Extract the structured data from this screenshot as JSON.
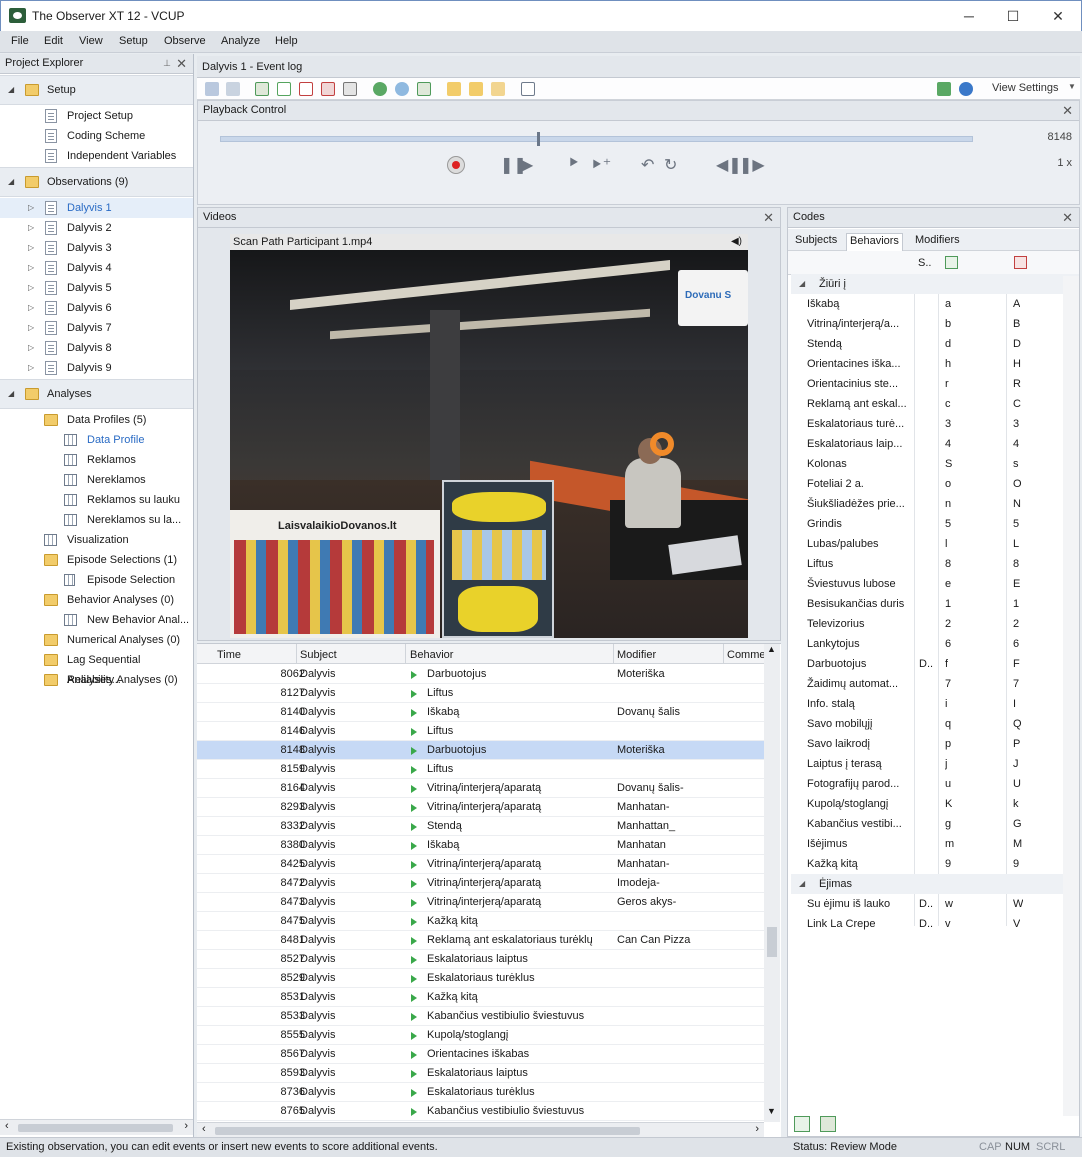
{
  "window": {
    "title": "The Observer XT 12 - VCUP",
    "minimize": "─",
    "maximize": "☐",
    "close": "✕"
  },
  "menu": [
    "File",
    "Edit",
    "View",
    "Setup",
    "Observe",
    "Analyze",
    "Help"
  ],
  "explorer": {
    "title": "Project Explorer",
    "pin": "📌",
    "close": "✕",
    "setup": {
      "label": "Setup",
      "items": [
        "Project Setup",
        "Coding Scheme",
        "Independent Variables"
      ]
    },
    "observations": {
      "label": "Observations (9)",
      "items": [
        "Dalyvis 1",
        "Dalyvis 2",
        "Dalyvis 3",
        "Dalyvis 4",
        "Dalyvis 5",
        "Dalyvis 6",
        "Dalyvis 7",
        "Dalyvis 8",
        "Dalyvis 9"
      ]
    },
    "analyses": {
      "label": "Analyses",
      "data_profiles": "Data Profiles (5)",
      "profiles": [
        "Data Profile",
        "Reklamos",
        "Nereklamos",
        "Reklamos su lauku",
        "Nereklamos su la..."
      ],
      "visualization": "Visualization",
      "episode_selections": "Episode Selections (1)",
      "episode_selection": "Episode Selection",
      "behavior_analyses": "Behavior Analyses (0)",
      "new_behavior": "New Behavior Anal...",
      "numerical": "Numerical Analyses (0)",
      "lag": "Lag Sequential Analyses...",
      "reliability": "Reliability Analyses (0)"
    }
  },
  "event_log_tab": "Dalyvis 1 - Event log",
  "view_settings": "View Settings",
  "playback": {
    "title": "Playback Control",
    "position": 0.42,
    "time": "8148",
    "speed": "1 x"
  },
  "videos": {
    "title": "Videos",
    "filename": "Scan Path Participant 1.mp4",
    "sign_text": "LaisvalaikioDovanos.lt",
    "sign_right": "Dovanu S"
  },
  "log": {
    "headers": [
      "Time",
      "Subject",
      "Behavior",
      "Modifier",
      "Comme"
    ],
    "rows": [
      {
        "time": "8062",
        "subject": "Dalyvis",
        "behavior": "Darbuotojus",
        "modifier": "Moteriška"
      },
      {
        "time": "8127",
        "subject": "Dalyvis",
        "behavior": "Liftus",
        "modifier": ""
      },
      {
        "time": "8140",
        "subject": "Dalyvis",
        "behavior": "Iškabą",
        "modifier": "Dovanų šalis"
      },
      {
        "time": "8146",
        "subject": "Dalyvis",
        "behavior": "Liftus",
        "modifier": ""
      },
      {
        "time": "8148",
        "subject": "Dalyvis",
        "behavior": "Darbuotojus",
        "modifier": "Moteriška"
      },
      {
        "time": "8159",
        "subject": "Dalyvis",
        "behavior": "Liftus",
        "modifier": ""
      },
      {
        "time": "8164",
        "subject": "Dalyvis",
        "behavior": "Vitriną/interjerą/aparatą",
        "modifier": "Dovanų šalis-"
      },
      {
        "time": "8293",
        "subject": "Dalyvis",
        "behavior": "Vitriną/interjerą/aparatą",
        "modifier": "Manhatan-"
      },
      {
        "time": "8332",
        "subject": "Dalyvis",
        "behavior": "Stendą",
        "modifier": "Manhattan_"
      },
      {
        "time": "8380",
        "subject": "Dalyvis",
        "behavior": "Iškabą",
        "modifier": "Manhatan"
      },
      {
        "time": "8425",
        "subject": "Dalyvis",
        "behavior": "Vitriną/interjerą/aparatą",
        "modifier": "Manhatan-"
      },
      {
        "time": "8472",
        "subject": "Dalyvis",
        "behavior": "Vitriną/interjerą/aparatą",
        "modifier": "Imodeja-"
      },
      {
        "time": "8473",
        "subject": "Dalyvis",
        "behavior": "Vitriną/interjerą/aparatą",
        "modifier": "Geros akys-"
      },
      {
        "time": "8475",
        "subject": "Dalyvis",
        "behavior": "Kažką kitą",
        "modifier": ""
      },
      {
        "time": "8481",
        "subject": "Dalyvis",
        "behavior": "Reklamą ant eskalatoriaus turėklų",
        "modifier": "Can Can Pizza"
      },
      {
        "time": "8527",
        "subject": "Dalyvis",
        "behavior": "Eskalatoriaus laiptus",
        "modifier": ""
      },
      {
        "time": "8529",
        "subject": "Dalyvis",
        "behavior": "Eskalatoriaus turėklus",
        "modifier": ""
      },
      {
        "time": "8531",
        "subject": "Dalyvis",
        "behavior": "Kažką kitą",
        "modifier": ""
      },
      {
        "time": "8533",
        "subject": "Dalyvis",
        "behavior": "Kabančius vestibiulio šviestuvus",
        "modifier": ""
      },
      {
        "time": "8555",
        "subject": "Dalyvis",
        "behavior": "Kupolą/stoglangį",
        "modifier": ""
      },
      {
        "time": "8567",
        "subject": "Dalyvis",
        "behavior": "Orientacines iškabas",
        "modifier": ""
      },
      {
        "time": "8593",
        "subject": "Dalyvis",
        "behavior": "Eskalatoriaus laiptus",
        "modifier": ""
      },
      {
        "time": "8736",
        "subject": "Dalyvis",
        "behavior": "Eskalatoriaus turėklus",
        "modifier": ""
      },
      {
        "time": "8765",
        "subject": "Dalyvis",
        "behavior": "Kabančius vestibiulio šviestuvus",
        "modifier": ""
      }
    ]
  },
  "codes": {
    "title": "Codes",
    "tabs": [
      "Subjects",
      "Behaviors",
      "Modifiers"
    ],
    "col_s": "S..",
    "group1": "Žiūri į",
    "rows1": [
      {
        "name": "Iškabą",
        "s": "",
        "key": "a",
        "end": "A"
      },
      {
        "name": "Vitriną/interjerą/a...",
        "s": "",
        "key": "b",
        "end": "B"
      },
      {
        "name": "Stendą",
        "s": "",
        "key": "d",
        "end": "D"
      },
      {
        "name": "Orientacines iška...",
        "s": "",
        "key": "h",
        "end": "H"
      },
      {
        "name": "Orientacinius ste...",
        "s": "",
        "key": "r",
        "end": "R"
      },
      {
        "name": "Reklamą ant eskal...",
        "s": "",
        "key": "c",
        "end": "C"
      },
      {
        "name": "Eskalatoriaus turė...",
        "s": "",
        "key": "3",
        "end": "3"
      },
      {
        "name": "Eskalatoriaus laip...",
        "s": "",
        "key": "4",
        "end": "4"
      },
      {
        "name": "Kolonas",
        "s": "",
        "key": "S",
        "end": "s"
      },
      {
        "name": "Foteliai 2 a.",
        "s": "",
        "key": "o",
        "end": "O"
      },
      {
        "name": "Šiukšliadėžes prie...",
        "s": "",
        "key": "n",
        "end": "N"
      },
      {
        "name": "Grindis",
        "s": "",
        "key": "5",
        "end": "5"
      },
      {
        "name": "Lubas/palubes",
        "s": "",
        "key": "l",
        "end": "L"
      },
      {
        "name": "Liftus",
        "s": "",
        "key": "8",
        "end": "8"
      },
      {
        "name": "Šviestuvus lubose",
        "s": "",
        "key": "e",
        "end": "E"
      },
      {
        "name": "Besisukančias duris",
        "s": "",
        "key": "1",
        "end": "1"
      },
      {
        "name": "Televizorius",
        "s": "",
        "key": "2",
        "end": "2"
      },
      {
        "name": "Lankytojus",
        "s": "",
        "key": "6",
        "end": "6"
      },
      {
        "name": "Darbuotojus",
        "s": "D..",
        "key": "f",
        "end": "F"
      },
      {
        "name": "Žaidimų automat...",
        "s": "",
        "key": "7",
        "end": "7"
      },
      {
        "name": "Info. stalą",
        "s": "",
        "key": "i",
        "end": "I"
      },
      {
        "name": "Savo mobilųjį",
        "s": "",
        "key": "q",
        "end": "Q"
      },
      {
        "name": "Savo laikrodį",
        "s": "",
        "key": "p",
        "end": "P"
      },
      {
        "name": "Laiptus į terasą",
        "s": "",
        "key": "j",
        "end": "J"
      },
      {
        "name": "Fotografijų parod...",
        "s": "",
        "key": "u",
        "end": "U"
      },
      {
        "name": "Kupolą/stoglangį",
        "s": "",
        "key": "K",
        "end": "k"
      },
      {
        "name": "Kabančius vestibi...",
        "s": "",
        "key": "g",
        "end": "G"
      },
      {
        "name": "Išėjimus",
        "s": "",
        "key": "m",
        "end": "M"
      },
      {
        "name": "Kažką kitą",
        "s": "",
        "key": "9",
        "end": "9"
      }
    ],
    "group2": "Ėjimas",
    "rows2": [
      {
        "name": "Su ėjimu iš lauko",
        "s": "D..",
        "key": "w",
        "end": "W"
      },
      {
        "name": "Link La Crepe",
        "s": "D..",
        "key": "v",
        "end": "V"
      }
    ]
  },
  "status": {
    "message": "Existing observation, you can edit events or insert new events to score additional events.",
    "mode": "Status: Review Mode",
    "cap": "CAP",
    "num": "NUM",
    "scrl": "SCRL"
  }
}
